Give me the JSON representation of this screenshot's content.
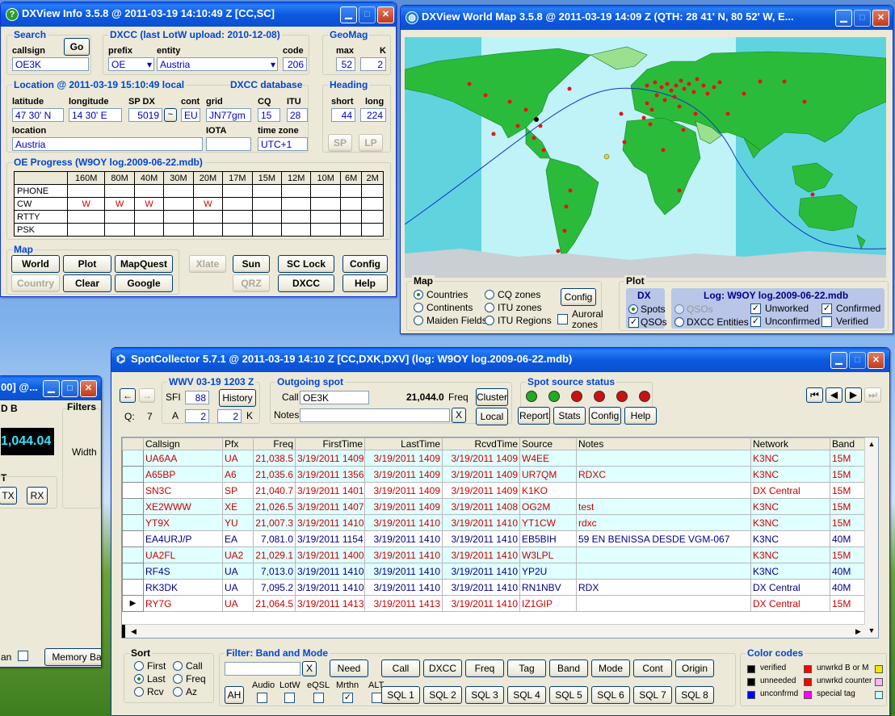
{
  "info": {
    "title": "DXView Info 3.5.8 @ 2011-03-19  14:10:49 Z  [CC,SC]",
    "search": {
      "label": "Search",
      "callsign_label": "callsign",
      "callsign": "OE3K",
      "go": "Go"
    },
    "dxcc": {
      "label": "DXCC  (last LotW upload: 2010-12-08)",
      "prefix_label": "prefix",
      "prefix": "OE",
      "entity_label": "entity",
      "entity": "Austria",
      "code_label": "code",
      "code": "206"
    },
    "geomag": {
      "label": "GeoMag",
      "max_label": "max",
      "max": "52",
      "k_label": "K",
      "k": "2"
    },
    "location": {
      "label": "Location @ 2011-03-19 15:10:49 local",
      "db_label": "DXCC database",
      "lat_label": "latitude",
      "lat": "47  30' N",
      "lon_label": "longitude",
      "lon": "14  30' E",
      "spdx_label": "SP DX",
      "spdx": "5019",
      "cont_label": "cont",
      "cont": "EU",
      "grid_label": "grid",
      "grid": "JN77gm",
      "cq_label": "CQ",
      "cq": "15",
      "itu_label": "ITU",
      "itu": "28",
      "loc_label": "location",
      "loc": "Austria",
      "iota_label": "IOTA",
      "iota": "",
      "tz_label": "time zone",
      "tz": "UTC+1"
    },
    "heading": {
      "label": "Heading",
      "short_label": "short",
      "short": "44",
      "long_label": "long",
      "long": "224",
      "sp": "SP",
      "lp": "LP"
    },
    "progress": {
      "label": "OE Progress (W9OY log.2009-06-22.mdb)",
      "bands": [
        "160M",
        "80M",
        "40M",
        "30M",
        "20M",
        "17M",
        "15M",
        "12M",
        "10M",
        "6M",
        "2M"
      ],
      "rows": [
        {
          "mode": "PHONE",
          "cells": [
            "",
            "",
            "",
            "",
            "",
            "",
            "",
            "",
            "",
            "",
            ""
          ]
        },
        {
          "mode": "CW",
          "cells": [
            "W",
            "W",
            "W",
            "",
            "W",
            "",
            "",
            "",
            "",
            "",
            ""
          ]
        },
        {
          "mode": "RTTY",
          "cells": [
            "",
            "",
            "",
            "",
            "",
            "",
            "",
            "",
            "",
            "",
            ""
          ]
        },
        {
          "mode": "PSK",
          "cells": [
            "",
            "",
            "",
            "",
            "",
            "",
            "",
            "",
            "",
            "",
            ""
          ]
        }
      ]
    },
    "mapgrp": {
      "label": "Map",
      "buttons": [
        "World",
        "Plot",
        "MapQuest",
        "Xlate",
        "Sun",
        "SC Lock",
        "Config",
        "Country",
        "Clear",
        "Google",
        "QRZ",
        "DXCC",
        "Help"
      ]
    }
  },
  "worldmap": {
    "title": "DXView World Map 3.5.8 @ 2011-03-19  14:09 Z  (QTH:  28  41' N,  80  52' W, E...",
    "map_label": "Map",
    "map_opts": [
      "Countries",
      "Continents",
      "Maiden Fields",
      "CQ zones",
      "ITU zones",
      "ITU Regions"
    ],
    "config": "Config",
    "auroral": "Auroral zones",
    "plot_label": "Plot",
    "dx_label": "DX",
    "spots": "Spots",
    "qsos": "QSOs",
    "log_label": "Log: W9OY log.2009-06-22.mdb",
    "log_qsos": "QSOs",
    "dxcc_entities": "DXCC Entities",
    "unworked": "Unworked",
    "unconfirmed": "Unconfirmed",
    "confirmed": "Confirmed",
    "verified": "Verified"
  },
  "leftwin": {
    "title": "00] @...",
    "db": "D B",
    "filters": "Filters",
    "value": "1,044.04",
    "width": "Width",
    "t": "T",
    "tx": "TX",
    "rx": "RX",
    "an": "an",
    "memory": "Memory Ba"
  },
  "spot": {
    "title": "SpotCollector 5.7.1 @ 2011-03-19  14:10 Z [CC,DXK,DXV]  (log: W9OY log.2009-06-22.mdb)",
    "q_label": "Q:",
    "q": "7",
    "wwv": {
      "label": "WWV 03-19 1203 Z",
      "sfi_label": "SFI",
      "sfi": "88",
      "history": "History",
      "a_label": "A",
      "a": "2",
      "k": "2",
      "k_label": "K"
    },
    "outgoing": {
      "label": "Outgoing spot",
      "call_label": "Call",
      "call": "OE3K",
      "freq": "21,044.0",
      "freq_label": "Freq",
      "cluster": "Cluster",
      "notes_label": "Notes",
      "notes": "",
      "x": "X",
      "local": "Local"
    },
    "source": {
      "label": "Spot source status",
      "leds": [
        "#22aa22",
        "#22aa22",
        "#cc1111",
        "#cc1111",
        "#cc1111",
        "#cc1111"
      ],
      "report": "Report",
      "stats": "Stats",
      "config": "Config",
      "help": "Help"
    },
    "columns": [
      "Callsign",
      "Pfx",
      "Freq",
      "FirstTime",
      "LastTime",
      "RcvdTime",
      "Source",
      "Notes",
      "Network",
      "Band"
    ],
    "rows": [
      {
        "call": "UA6AA",
        "pfx": "UA",
        "freq": "21,038.5",
        "first": "3/19/2011 1409",
        "last": "3/19/2011 1409",
        "rcvd": "3/19/2011 1409",
        "src": "W4EE",
        "notes": "",
        "net": "K3NC",
        "band": "15M",
        "bg": "a",
        "col": "rt"
      },
      {
        "call": "A65BP",
        "pfx": "A6",
        "freq": "21,035.6",
        "first": "3/19/2011 1356",
        "last": "3/19/2011 1409",
        "rcvd": "3/19/2011 1409",
        "src": "UR7QM",
        "notes": "RDXC",
        "net": "K3NC",
        "band": "15M",
        "bg": "a",
        "col": "rt"
      },
      {
        "call": "SN3C",
        "pfx": "SP",
        "freq": "21,040.7",
        "first": "3/19/2011 1401",
        "last": "3/19/2011 1409",
        "rcvd": "3/19/2011 1409",
        "src": "K1KO",
        "notes": "",
        "net": "DX Central",
        "band": "15M",
        "bg": "b",
        "col": "rt"
      },
      {
        "call": "XE2WWW",
        "pfx": "XE",
        "freq": "21,026.5",
        "first": "3/19/2011 1407",
        "last": "3/19/2011 1409",
        "rcvd": "3/19/2011 1408",
        "src": "OG2M",
        "notes": "test",
        "net": "K3NC",
        "band": "15M",
        "bg": "a",
        "col": "rt"
      },
      {
        "call": "YT9X",
        "pfx": "YU",
        "freq": "21,007.3",
        "first": "3/19/2011 1410",
        "last": "3/19/2011 1410",
        "rcvd": "3/19/2011 1410",
        "src": "YT1CW",
        "notes": "rdxc",
        "net": "K3NC",
        "band": "15M",
        "bg": "a",
        "col": "rt"
      },
      {
        "call": "EA4URJ/P",
        "pfx": "EA",
        "freq": "7,081.0",
        "first": "3/19/2011 1154",
        "last": "3/19/2011 1410",
        "rcvd": "3/19/2011 1410",
        "src": "EB5BIH",
        "notes": "59 EN BENISSA  DESDE  VGM-067",
        "net": "K3NC",
        "band": "40M",
        "bg": "b",
        "col": "bl"
      },
      {
        "call": "UA2FL",
        "pfx": "UA2",
        "freq": "21,029.1",
        "first": "3/19/2011 1400",
        "last": "3/19/2011 1410",
        "rcvd": "3/19/2011 1410",
        "src": "W3LPL",
        "notes": "",
        "net": "K3NC",
        "band": "15M",
        "bg": "a",
        "col": "rt"
      },
      {
        "call": "RF4S",
        "pfx": "UA",
        "freq": "7,013.0",
        "first": "3/19/2011 1410",
        "last": "3/19/2011 1410",
        "rcvd": "3/19/2011 1410",
        "src": "YP2U",
        "notes": "",
        "net": "K3NC",
        "band": "40M",
        "bg": "a",
        "col": "bl"
      },
      {
        "call": "RK3DK",
        "pfx": "UA",
        "freq": "7,095.2",
        "first": "3/19/2011 1410",
        "last": "3/19/2011 1410",
        "rcvd": "3/19/2011 1410",
        "src": "RN1NBV",
        "notes": "RDX",
        "net": "DX Central",
        "band": "40M",
        "bg": "b",
        "col": "bl"
      },
      {
        "call": "RY7G",
        "pfx": "UA",
        "freq": "21,064.5",
        "first": "3/19/2011 1413",
        "last": "3/19/2011 1413",
        "rcvd": "3/19/2011 1410",
        "src": "IZ1GIP",
        "notes": "",
        "net": "DX Central",
        "band": "15M",
        "bg": "b",
        "col": "rt"
      }
    ],
    "sort": {
      "label": "Sort",
      "opts": [
        "First",
        "Last",
        "Rcv",
        "Call",
        "Freq",
        "Az"
      ]
    },
    "filter": {
      "label": "Filter: Band and Mode",
      "x": "X",
      "need": "Need",
      "buttons1": [
        "Call",
        "DXCC",
        "Freq",
        "Tag",
        "Band",
        "Mode",
        "Cont",
        "Origin"
      ],
      "buttons2": [
        "SQL 1",
        "SQL 2",
        "SQL 3",
        "SQL 4",
        "SQL 5",
        "SQL 6",
        "SQL 7",
        "SQL 8"
      ],
      "ah": "AH",
      "checks": [
        "Audio",
        "LotW",
        "eQSL",
        "Mrthn",
        "ALT"
      ]
    },
    "colors": {
      "label": "Color codes",
      "items": [
        {
          "text": "verified",
          "color": "#000000"
        },
        {
          "text": "unneeded",
          "color": "#000000"
        },
        {
          "text": "unconfrmd",
          "color": "#0000ff"
        },
        {
          "text": "unwrkd B or M",
          "color": "#ff0000"
        },
        {
          "text": "unwrkd counter",
          "color": "#ff0000"
        },
        {
          "text": "special tag",
          "color": "#ff00ff"
        }
      ]
    }
  }
}
